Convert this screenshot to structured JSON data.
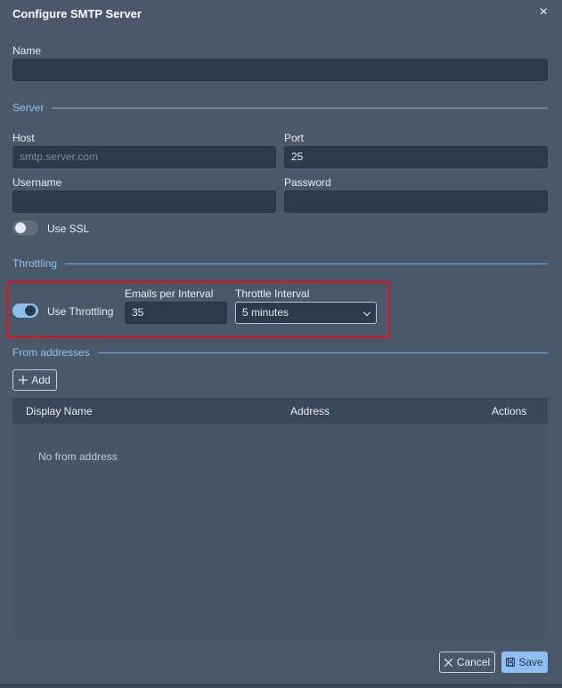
{
  "dialog": {
    "title": "Configure SMTP Server",
    "close": "×"
  },
  "name": {
    "label": "Name",
    "value": ""
  },
  "server_section": "Server",
  "host": {
    "label": "Host",
    "placeholder": "smtp.server.com"
  },
  "port": {
    "label": "Port",
    "value": "25"
  },
  "username": {
    "label": "Username",
    "value": ""
  },
  "password": {
    "label": "Password",
    "value": ""
  },
  "ssl": {
    "label": "Use SSL",
    "on": false
  },
  "throttling_section": "Throttling",
  "throttling": {
    "label": "Use Throttling",
    "on": true
  },
  "emails_per_interval": {
    "label": "Emails per Interval",
    "value": "35"
  },
  "throttle_interval": {
    "label": "Throttle Interval",
    "selected": "5 minutes"
  },
  "from_section": "From addresses",
  "add_button": {
    "icon": "plus-icon",
    "label": "Add"
  },
  "table": {
    "columns": [
      "Display Name",
      "Address",
      "Actions"
    ],
    "empty_text": "No from address"
  },
  "footer": {
    "cancel": "Cancel",
    "save": "Save"
  },
  "colors": {
    "accent": "#8fbff0",
    "background": "#4a586a",
    "input": "#2e3a4a",
    "highlight": "#e0121b"
  }
}
